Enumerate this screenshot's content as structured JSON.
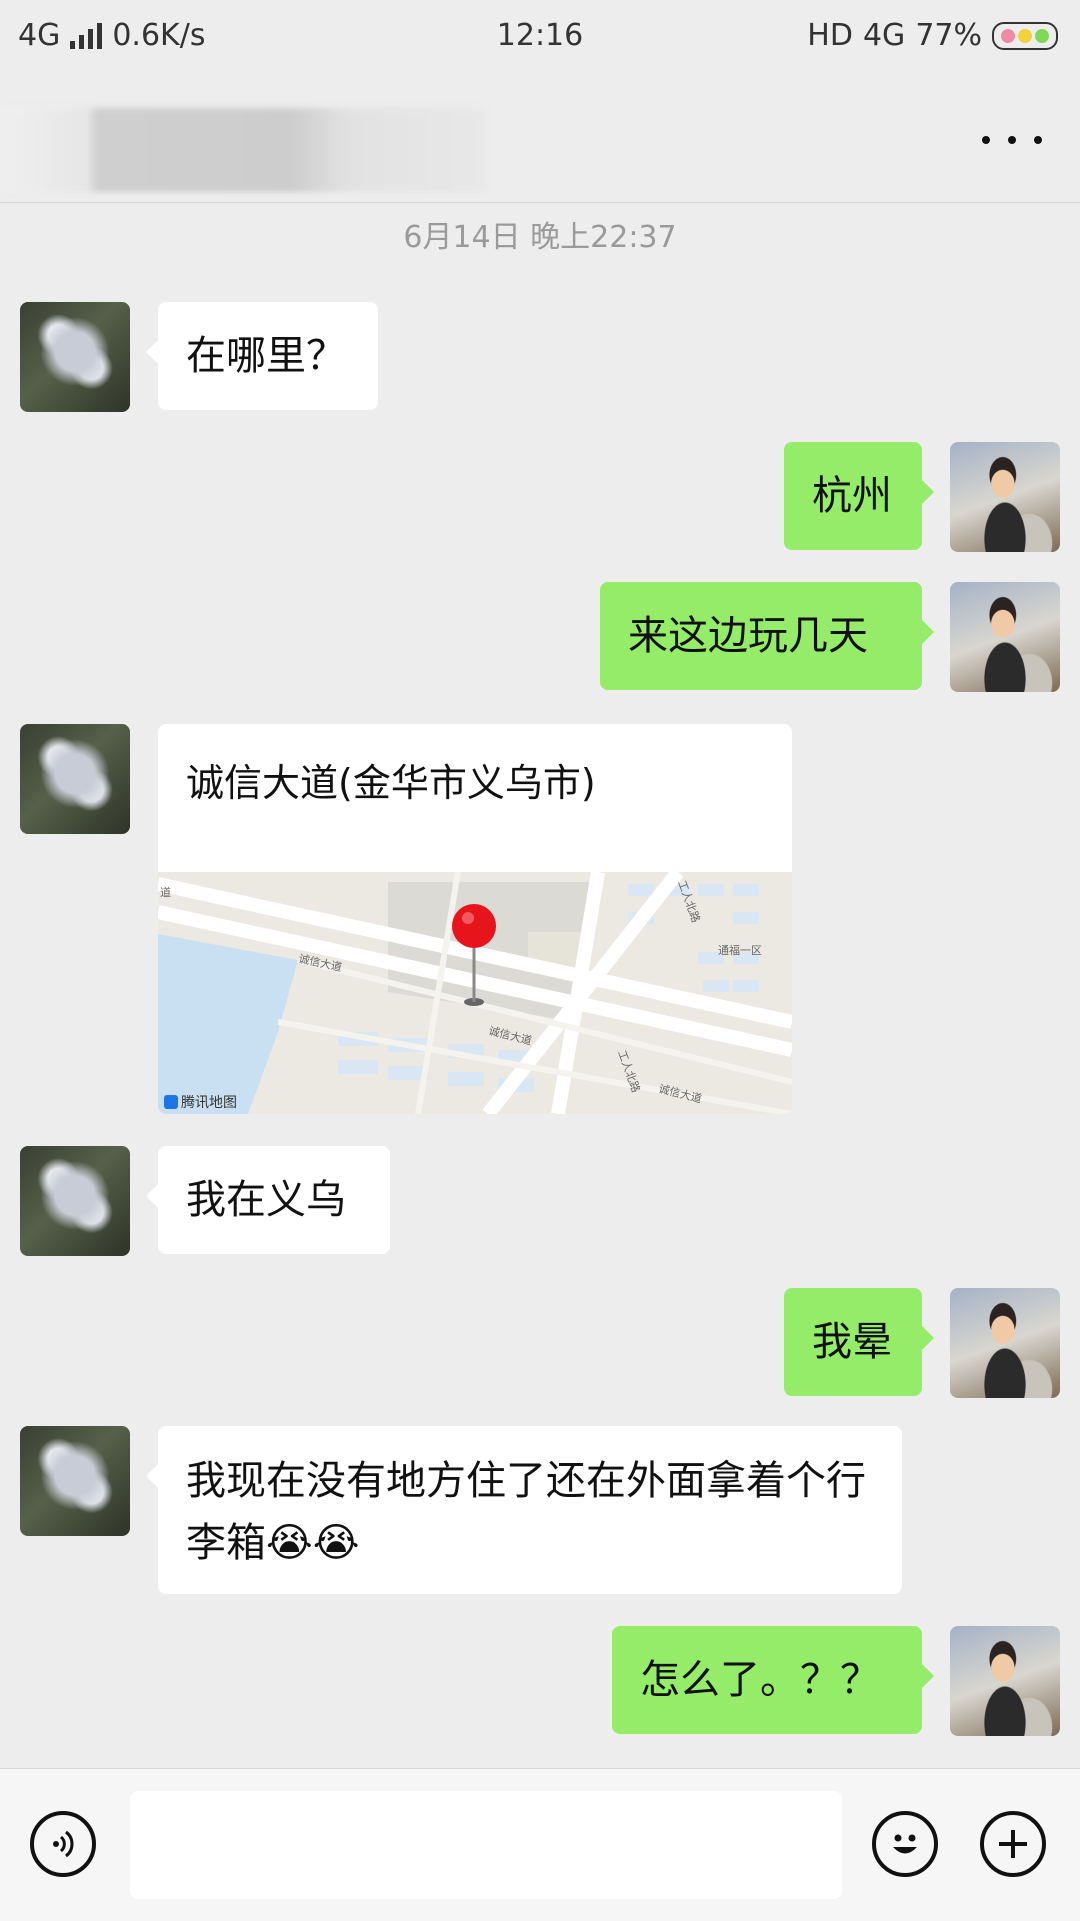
{
  "status_bar": {
    "network": "4G",
    "speed": "0.6K/s",
    "time": "12:16",
    "hd": "HD",
    "network_right": "4G",
    "battery": "77%"
  },
  "timestamp": "6月14日 晚上22:37",
  "messages": [
    {
      "from": "other",
      "text": "在哪里？"
    },
    {
      "from": "self",
      "text": "杭州"
    },
    {
      "from": "self",
      "text": "来这边玩几天"
    },
    {
      "from": "other",
      "type": "location",
      "text": "诚信大道(金华市义乌市)"
    },
    {
      "from": "other",
      "text": "我在义乌"
    },
    {
      "from": "self",
      "text": "我晕"
    },
    {
      "from": "other",
      "text": "我现在没有地方住了还在外面拿着个行李箱😭😭"
    },
    {
      "from": "self",
      "text": "怎么了。？？"
    }
  ],
  "map": {
    "logo": "腾讯地图",
    "road_1": "诚信大道",
    "road_2": "诚信大道",
    "road_3": "诚信大道",
    "road_4": "工人北路",
    "road_5": "工人北路",
    "poi": "通福一区",
    "road_6": "道"
  },
  "colors": {
    "background": "#ededed",
    "self_bubble": "#95ec69",
    "other_bubble": "#ffffff",
    "pin": "#e8141b"
  },
  "icons": {
    "more": "more-icon",
    "voice": "voice-icon",
    "emoji": "emoji-icon",
    "plus": "plus-icon"
  }
}
